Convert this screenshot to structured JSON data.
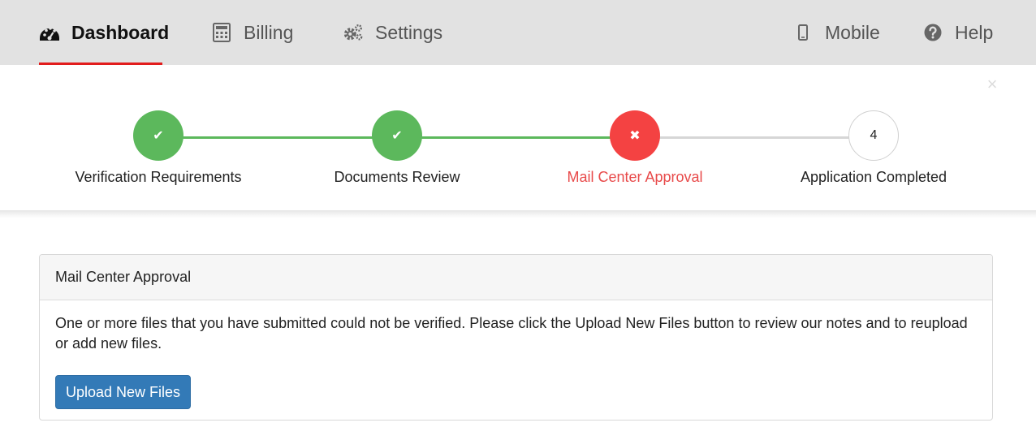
{
  "nav": {
    "dashboard": {
      "label": "Dashboard",
      "icon": "dashboard-gauge-icon"
    },
    "billing": {
      "label": "Billing",
      "icon": "calculator-icon"
    },
    "settings": {
      "label": "Settings",
      "icon": "gears-icon"
    },
    "mobile": {
      "label": "Mobile",
      "icon": "mobile-phone-icon"
    },
    "help": {
      "label": "Help",
      "icon": "question-circle-icon"
    },
    "active_item": "dashboard",
    "active_underline_color": "#e21c1c"
  },
  "close_symbol": "×",
  "stepper": {
    "steps": [
      {
        "label": "Verification Requirements",
        "status": "done",
        "icon": "check-icon",
        "symbol": "✔"
      },
      {
        "label": "Documents Review",
        "status": "done",
        "icon": "check-icon",
        "symbol": "✔"
      },
      {
        "label": "Mail Center Approval",
        "status": "error",
        "icon": "x-icon",
        "symbol": "✖"
      },
      {
        "label": "Application Completed",
        "status": "todo",
        "number": "4"
      }
    ],
    "colors": {
      "done": "#5cb85c",
      "error": "#f44242",
      "pending_line": "#d6d6d6"
    }
  },
  "panel": {
    "title": "Mail Center Approval",
    "message": "One or more files that you have submitted could not be verified. Please click the Upload New Files button to review our notes and to reupload or add new files.",
    "upload_button": "Upload New Files",
    "button_color": "#337ab7"
  }
}
